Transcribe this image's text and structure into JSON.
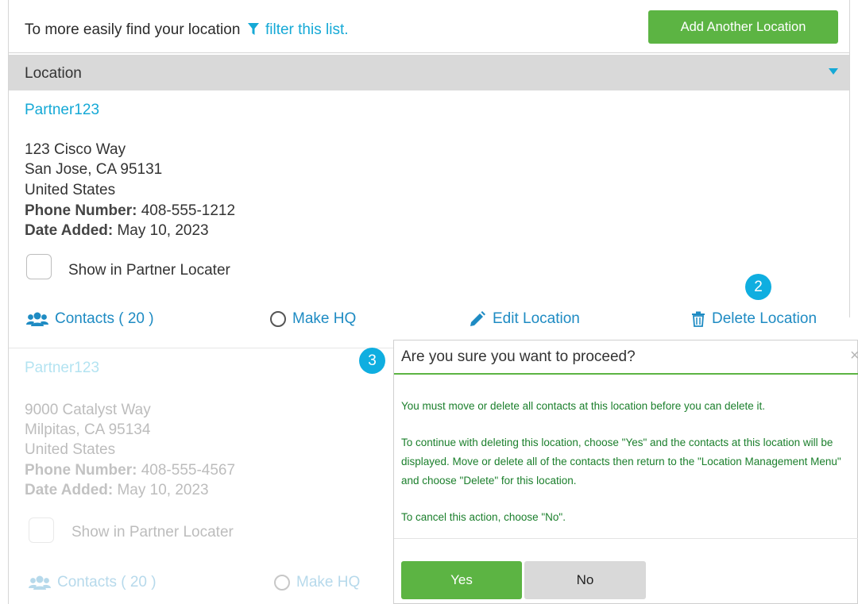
{
  "intro": {
    "text": "To more easily find your location",
    "filter_link": "filter this list."
  },
  "add_button": "Add Another Location",
  "list_header": {
    "label": "Location"
  },
  "colors": {
    "link": "#15a9d6",
    "action": "#1e8bc3",
    "green": "#5cb443",
    "badge": "#0faee0",
    "modal_text": "#1b7f2c"
  },
  "locations": [
    {
      "name": "Partner123",
      "address1": "123 Cisco Way",
      "address2": "San Jose, CA 95131",
      "country": "United States",
      "phone_label": "Phone Number:",
      "phone": "408-555-1212",
      "date_label": "Date Added:",
      "date": "May 10, 2023",
      "show_label": "Show in Partner Locater",
      "contacts": "Contacts ( 20 )",
      "make_hq": "Make HQ",
      "edit": "Edit Location",
      "delete": "Delete Location"
    },
    {
      "name": "Partner123",
      "address1": "9000 Catalyst Way",
      "address2": "Milpitas, CA 95134",
      "country": "United States",
      "phone_label": "Phone Number:",
      "phone": "408-555-4567",
      "date_label": "Date Added:",
      "date": "May 10, 2023",
      "show_label": "Show in Partner Locater",
      "contacts": "Contacts ( 20 )",
      "make_hq": "Make HQ"
    }
  ],
  "callouts": {
    "step2": "2",
    "step3": "3"
  },
  "dialog": {
    "title": "Are you sure you want to proceed?",
    "close": "×",
    "p1": "You must move or delete all contacts at this location before you can delete it.",
    "p2": "To continue with deleting this location, choose \"Yes\" and the contacts at this location will be displayed. Move or delete all of the contacts then return to the \"Location Management Menu\" and choose \"Delete\" for this location.",
    "p3": "To cancel this action, choose \"No\".",
    "yes": "Yes",
    "no": "No"
  }
}
